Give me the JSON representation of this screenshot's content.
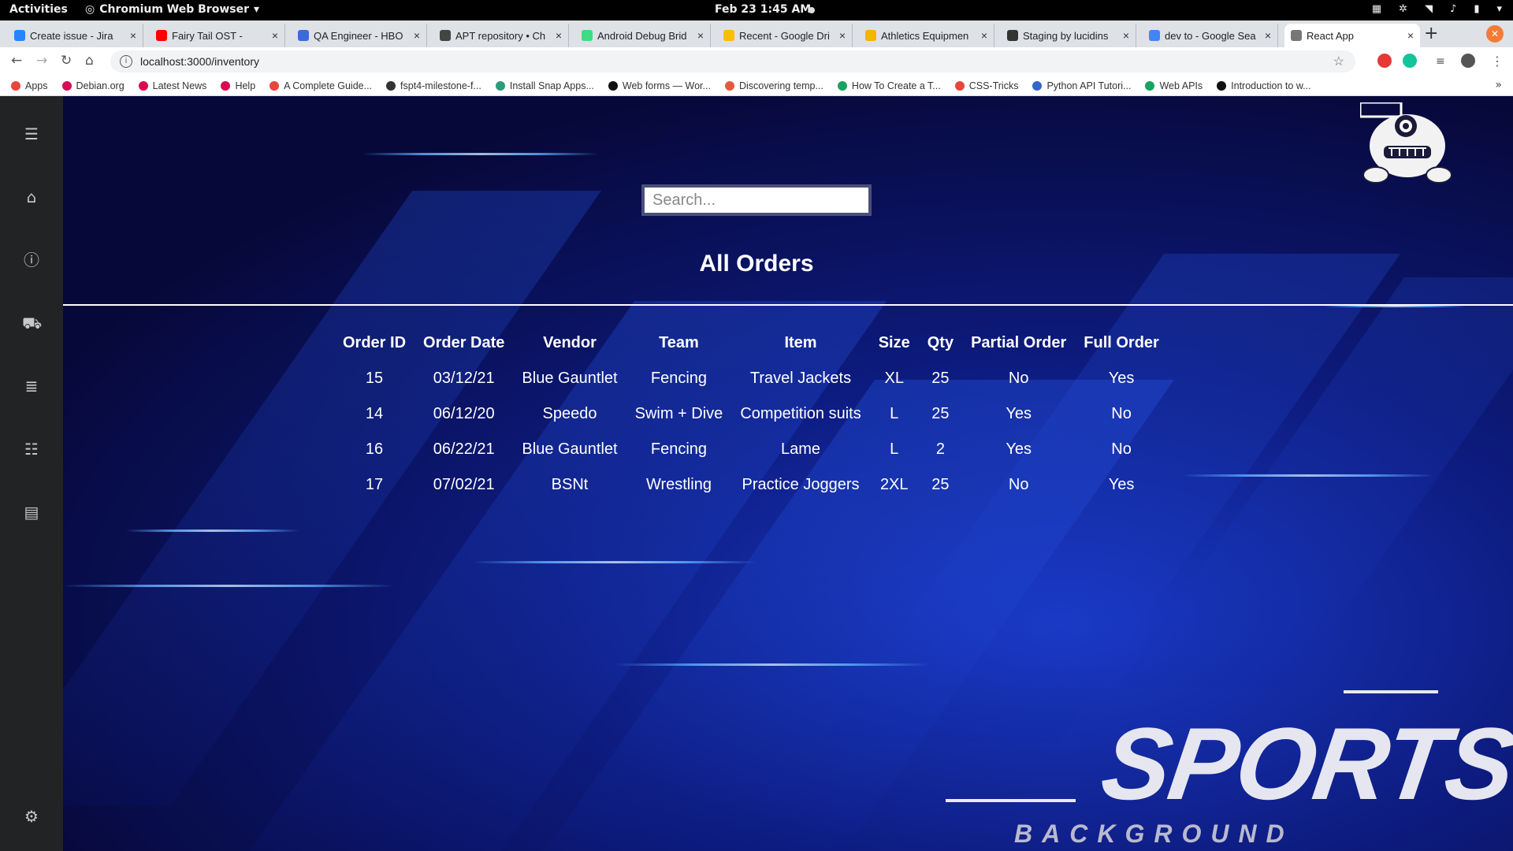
{
  "system": {
    "activities": "Activities",
    "app_name": "Chromium Web Browser",
    "clock": "Feb 23  1:45 AM"
  },
  "browser": {
    "tabs": [
      {
        "title": "Create issue - Jira",
        "color": "#2684ff"
      },
      {
        "title": "Fairy Tail OST - ",
        "color": "#ff0000"
      },
      {
        "title": "QA Engineer - HBO",
        "color": "#3a6bd6"
      },
      {
        "title": "APT repository • Ch",
        "color": "#444444"
      },
      {
        "title": "Android Debug Brid",
        "color": "#3ddc84"
      },
      {
        "title": "Recent - Google Dri",
        "color": "#fbbc04"
      },
      {
        "title": "Athletics Equipmen",
        "color": "#f4b400"
      },
      {
        "title": "Staging by lucidins",
        "color": "#333333"
      },
      {
        "title": "dev to - Google Sea",
        "color": "#4285f4"
      },
      {
        "title": "React App",
        "color": "#777777",
        "active": true
      }
    ],
    "url": "localhost:3000/inventory",
    "bookmarks": [
      {
        "label": "Apps",
        "color": "#e8453c"
      },
      {
        "label": "Debian.org",
        "color": "#d70a53"
      },
      {
        "label": "Latest News",
        "color": "#d70a53"
      },
      {
        "label": "Help",
        "color": "#d70a53"
      },
      {
        "label": "A Complete Guide...",
        "color": "#e8453c"
      },
      {
        "label": "fspt4-milestone-f...",
        "color": "#333333"
      },
      {
        "label": "Install Snap Apps...",
        "color": "#2b9b7b"
      },
      {
        "label": "Web forms — Wor...",
        "color": "#111111"
      },
      {
        "label": "Discovering temp...",
        "color": "#e25a3c"
      },
      {
        "label": "How To Create a T...",
        "color": "#1aa260"
      },
      {
        "label": "CSS-Tricks",
        "color": "#e8453c"
      },
      {
        "label": "Python API Tutori...",
        "color": "#3366cc"
      },
      {
        "label": "Web APIs",
        "color": "#1aa260"
      },
      {
        "label": "Introduction to w...",
        "color": "#111111"
      }
    ]
  },
  "page": {
    "search_placeholder": "Search...",
    "heading": "All Orders",
    "columns": [
      "Order ID",
      "Order Date",
      "Vendor",
      "Team",
      "Item",
      "Size",
      "Qty",
      "Partial Order",
      "Full Order"
    ],
    "rows": [
      [
        "15",
        "03/12/21",
        "Blue Gauntlet",
        "Fencing",
        "Travel Jackets",
        "XL",
        "25",
        "No",
        "Yes"
      ],
      [
        "14",
        "06/12/20",
        "Speedo",
        "Swim + Dive",
        "Competition suits",
        "L",
        "25",
        "Yes",
        "No"
      ],
      [
        "16",
        "06/22/21",
        "Blue Gauntlet",
        "Fencing",
        "Lame",
        "L",
        "2",
        "Yes",
        "No"
      ],
      [
        "17",
        "07/02/21",
        "BSNt",
        "Wrestling",
        "Practice Joggers",
        "2XL",
        "25",
        "No",
        "Yes"
      ]
    ],
    "logo_main": "SPORTS",
    "logo_sub": "BACKGROUND"
  }
}
